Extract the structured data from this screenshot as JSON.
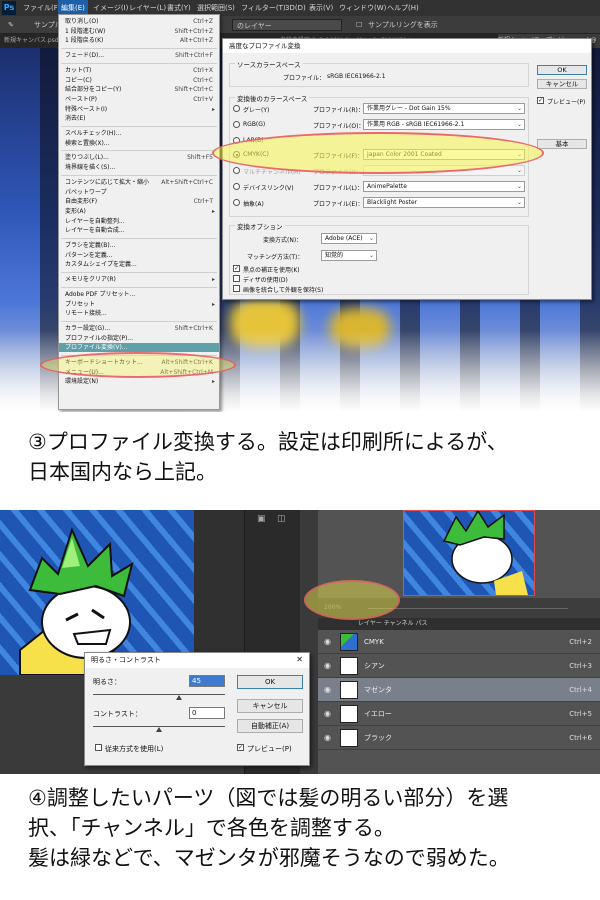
{
  "menubar": {
    "logo": "Ps",
    "items": [
      "ファイル(F)",
      "編集(E)",
      "イメージ(I)",
      "レイヤー(L)",
      "書式(Y)",
      "選択範囲(S)",
      "フィルター(T)",
      "3D(D)",
      "表示(V)",
      "ウィンドウ(W)",
      "ヘルプ(H)"
    ]
  },
  "optionsbar": {
    "sample_label": "サンプル",
    "layer_select": "のレイヤー",
    "show_sample_ring": "サンプルリングを表示"
  },
  "doctabs": {
    "left": "新規キャンバス.psd",
    "mid": "名称未設定-1 @ 100% (レイヤー 1, CMYK/8) *",
    "right": "新規キャンバス・プレビュー.psd @"
  },
  "edit_menu": {
    "items": [
      {
        "label": "取り消し(O)",
        "shortcut": "Ctrl+Z"
      },
      {
        "label": "1 段階進む(W)",
        "shortcut": "Shift+Ctrl+Z"
      },
      {
        "label": "1 段階戻る(K)",
        "shortcut": "Alt+Ctrl+Z"
      },
      {
        "label": "フェード(D)...",
        "shortcut": "Shift+Ctrl+F",
        "sep_before": true
      },
      {
        "label": "カット(T)",
        "shortcut": "Ctrl+X",
        "sep_before": true
      },
      {
        "label": "コピー(C)",
        "shortcut": "Ctrl+C"
      },
      {
        "label": "結合部分をコピー(Y)",
        "shortcut": "Shift+Ctrl+C"
      },
      {
        "label": "ペースト(P)",
        "shortcut": "Ctrl+V"
      },
      {
        "label": "特殊ペースト(I)",
        "shortcut": "",
        "arrow": true
      },
      {
        "label": "消去(E)",
        "shortcut": ""
      },
      {
        "label": "スペルチェック(H)...",
        "shortcut": "",
        "sep_before": true
      },
      {
        "label": "検索と置換(X)...",
        "shortcut": ""
      },
      {
        "label": "塗りつぶし(L)...",
        "shortcut": "Shift+F5",
        "sep_before": true
      },
      {
        "label": "境界線を描く(S)...",
        "shortcut": ""
      },
      {
        "label": "コンテンツに応じて拡大・縮小",
        "shortcut": "Alt+Shift+Ctrl+C",
        "sep_before": true
      },
      {
        "label": "パペットワープ",
        "shortcut": ""
      },
      {
        "label": "自由変形(F)",
        "shortcut": "Ctrl+T"
      },
      {
        "label": "変形(A)",
        "shortcut": "",
        "arrow": true
      },
      {
        "label": "レイヤーを自動整列...",
        "shortcut": ""
      },
      {
        "label": "レイヤーを自動合成...",
        "shortcut": ""
      },
      {
        "label": "ブラシを定義(B)...",
        "shortcut": "",
        "sep_before": true
      },
      {
        "label": "パターンを定義...",
        "shortcut": ""
      },
      {
        "label": "カスタムシェイプを定義...",
        "shortcut": ""
      },
      {
        "label": "メモリをクリア(R)",
        "shortcut": "",
        "arrow": true,
        "sep_before": true
      },
      {
        "label": "Adobe PDF プリセット...",
        "shortcut": "",
        "sep_before": true
      },
      {
        "label": "プリセット",
        "shortcut": "",
        "arrow": true
      },
      {
        "label": "リモート接続...",
        "shortcut": ""
      },
      {
        "label": "カラー設定(G)...",
        "shortcut": "Shift+Ctrl+K",
        "sep_before": true
      },
      {
        "label": "プロファイルの指定(P)...",
        "shortcut": ""
      },
      {
        "label": "プロファイル変換(V)...",
        "shortcut": "",
        "highlight": true
      },
      {
        "label": "キーボードショートカット...",
        "shortcut": "Alt+Shift+Ctrl+K",
        "sep_before": true
      },
      {
        "label": "メニュー(U)...",
        "shortcut": "Alt+Shift+Ctrl+M"
      },
      {
        "label": "環境設定(N)",
        "shortcut": "",
        "arrow": true
      }
    ]
  },
  "profile_dialog": {
    "title": "高度なプロファイル変換",
    "source_group": "ソースカラースペース",
    "source_label": "プロファイル：",
    "source_value": "sRGB IEC61966-2.1",
    "dest_group": "変換後のカラースペース",
    "rows": [
      {
        "radio": "グレー(Y)",
        "plabel": "プロファイル(R)：",
        "value": "作業用グレー - Dot Gain 15%",
        "selected": false,
        "disabled": false
      },
      {
        "radio": "RGB(G)",
        "plabel": "プロファイル(O)：",
        "value": "作業用 RGB - sRGB IEC61966-2.1",
        "selected": false,
        "disabled": false
      },
      {
        "radio": "LAB(B)",
        "plabel": "",
        "value": "",
        "selected": false,
        "disabled": false
      },
      {
        "radio": "CMYK(C)",
        "plabel": "プロファイル(F)：",
        "value": "Japan Color 2001 Coated",
        "selected": true,
        "disabled": false
      },
      {
        "radio": "マルチチャンネル(M)",
        "plabel": "プロファイル(I)：",
        "value": "",
        "selected": false,
        "disabled": true
      },
      {
        "radio": "デバイスリンク(V)",
        "plabel": "プロファイル(L)：",
        "value": "AnimePalette",
        "selected": false,
        "disabled": false
      },
      {
        "radio": "抽象(A)",
        "plabel": "プロファイル(E)：",
        "value": "Blacklight Poster",
        "selected": false,
        "disabled": false
      }
    ],
    "options_group": "変換オプション",
    "method_label": "変換方式(N)：",
    "method_value": "Adobe (ACE)",
    "intent_label": "マッチング方法(T)：",
    "intent_value": "知覚的",
    "checks": [
      {
        "label": "黒点の補正を使用(K)",
        "checked": true
      },
      {
        "label": "ディザの使用(D)",
        "checked": false
      },
      {
        "label": "画像を統合して外観を保持(S)",
        "checked": false
      }
    ],
    "ok": "OK",
    "cancel": "キャンセル",
    "preview": "プレビュー(P)",
    "basic": "基本"
  },
  "caption1": {
    "line1": "③プロファイル変換する。設定は印刷所によるが、",
    "line2": "日本国内なら上記。"
  },
  "channels": {
    "zoom": "100%",
    "tabs": "レイヤー チャンネル パス",
    "rows": [
      {
        "name": "CMYK",
        "shortcut": "Ctrl+2",
        "selected": false
      },
      {
        "name": "シアン",
        "shortcut": "Ctrl+3",
        "selected": false
      },
      {
        "name": "マゼンタ",
        "shortcut": "Ctrl+4",
        "selected": true
      },
      {
        "name": "イエロー",
        "shortcut": "Ctrl+5",
        "selected": false
      },
      {
        "name": "ブラック",
        "shortcut": "Ctrl+6",
        "selected": false
      }
    ]
  },
  "bc_dialog": {
    "title": "明るさ・コントラスト",
    "brightness_label": "明るさ：",
    "brightness_value": "45",
    "contrast_label": "コントラスト：",
    "contrast_value": "0",
    "legacy": "従来方式を使用(L)",
    "ok": "OK",
    "cancel": "キャンセル",
    "auto": "自動補正(A)",
    "preview": "プレビュー(P)"
  },
  "caption2": {
    "line1": "④調整したいパーツ（図では髪の明るい部分）を選",
    "line2": "択、「チャンネル」で各色を調整する。",
    "line3": "髪は緑などで、マゼンタが邪魔そうなので弱めた。"
  },
  "colors": {
    "highlight_yellow": "#f4f04a",
    "ellipse_pink": "#eb5064",
    "ps_panel": "#535353",
    "art_blue": "#1f56b3"
  }
}
